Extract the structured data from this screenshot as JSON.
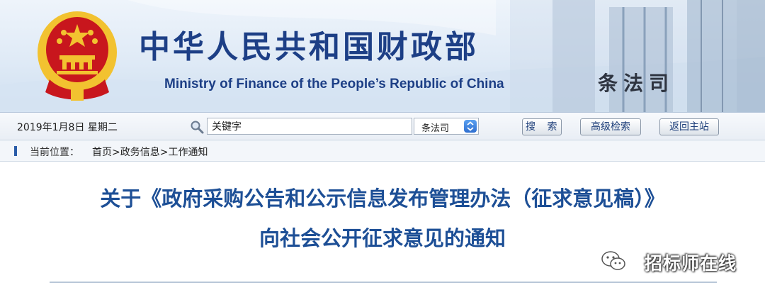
{
  "header": {
    "title_cn": "中华人民共和国财政部",
    "title_en": "Ministry of Finance of the People’s Republic of China",
    "department": "条法司",
    "emblem_icon": "national-emblem",
    "colors": {
      "title": "#1d3f86",
      "emblem_red": "#c8161d",
      "emblem_gold": "#f2c230"
    }
  },
  "toolbar": {
    "date": "2019年1月8日 星期二",
    "search_icon": "magnifier-icon",
    "search_value": "关键字",
    "dept_select": "条法司",
    "search_button": "搜 索",
    "advanced_button": "高级检索",
    "home_button": "返回主站"
  },
  "breadcrumb": {
    "label": "当前位置：",
    "items": [
      "首页",
      "政务信息",
      "工作通知"
    ],
    "separator": ">"
  },
  "article": {
    "title_line1": "关于《政府采购公告和公示信息发布管理办法（征求意见稿）》",
    "title_line2": "向社会公开征求意见的通知",
    "title_color": "#1d4f96"
  },
  "watermark": {
    "icon": "wechat-icon",
    "text": "招标师在线"
  }
}
